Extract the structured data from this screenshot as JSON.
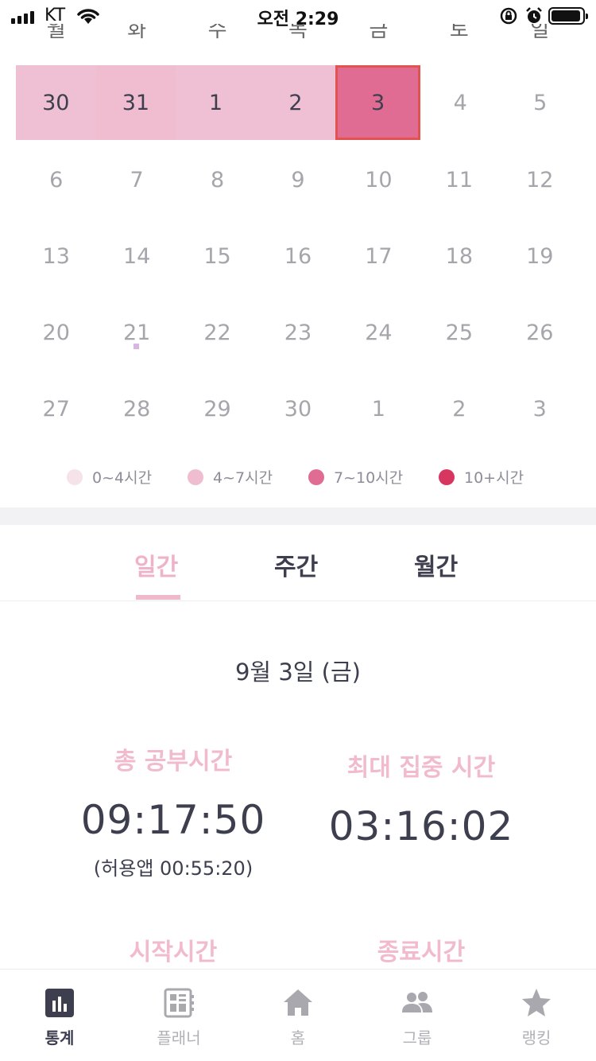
{
  "status_bar": {
    "carrier": "KT",
    "time": "오전 2:29"
  },
  "weekdays": [
    "월",
    "화",
    "수",
    "목",
    "금",
    "토",
    "일"
  ],
  "calendar": {
    "weeks": [
      [
        "30",
        "31",
        "1",
        "2",
        "3",
        "4",
        "5"
      ],
      [
        "6",
        "7",
        "8",
        "9",
        "10",
        "11",
        "12"
      ],
      [
        "13",
        "14",
        "15",
        "16",
        "17",
        "18",
        "19"
      ],
      [
        "20",
        "21",
        "22",
        "23",
        "24",
        "25",
        "26"
      ],
      [
        "27",
        "28",
        "29",
        "30",
        "1",
        "2",
        "3"
      ]
    ],
    "selected": "3"
  },
  "legend": [
    {
      "label": "0~4시간",
      "color": "#f6e3ea"
    },
    {
      "label": "4~7시간",
      "color": "#efbcd0"
    },
    {
      "label": "7~10시간",
      "color": "#e06b93"
    },
    {
      "label": "10+시간",
      "color": "#d6365f"
    }
  ],
  "tabs": {
    "daily": "일간",
    "weekly": "주간",
    "monthly": "월간"
  },
  "date_title": "9월 3일 (금)",
  "stats": {
    "total_label": "총 공부시간",
    "total_value": "09:17:50",
    "total_sub": "(허용앱  00:55:20)",
    "focus_label": "최대 집중 시간",
    "focus_value": "03:16:02",
    "start_label": "시작시간",
    "end_label": "종료시간"
  },
  "tabbar": {
    "stats": "통계",
    "planner": "플래너",
    "home": "홈",
    "group": "그룹",
    "ranking": "랭킹"
  },
  "colors": {
    "accent": "#f0b8cb",
    "selected_day": "#e06b93",
    "selected_border": "#e2524f",
    "text_dark": "#3d3f4e"
  }
}
